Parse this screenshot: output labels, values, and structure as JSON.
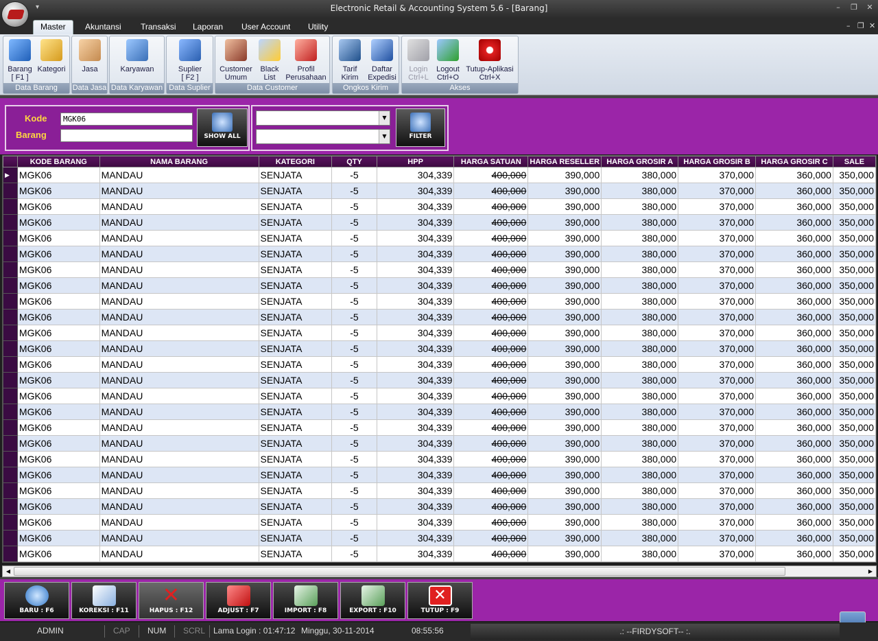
{
  "window": {
    "title": "Electronic Retail  & Accounting System 5.6 - [Barang]",
    "minimize_icon": "minimize-icon",
    "maximize_icon": "maximize-icon",
    "close_icon": "close-icon"
  },
  "menu": {
    "tabs": [
      "Master",
      "Akuntansi",
      "Transaksi",
      "Laporan",
      "User Account",
      "Utility"
    ],
    "active": "Master"
  },
  "ribbon": {
    "groups": [
      {
        "title": "Data Barang",
        "buttons": [
          {
            "label": "Barang",
            "sub": "[ F1 ]",
            "icon": "package-icon"
          },
          {
            "label": "Kategori",
            "sub": "",
            "icon": "tree-icon"
          }
        ]
      },
      {
        "title": "Data Jasa",
        "buttons": [
          {
            "label": "Jasa",
            "sub": "",
            "icon": "handshake-icon"
          }
        ]
      },
      {
        "title": "Data Karyawan",
        "buttons": [
          {
            "label": "Karyawan",
            "sub": "",
            "icon": "people-icon"
          }
        ]
      },
      {
        "title": "Data Suplier",
        "buttons": [
          {
            "label": "Suplier",
            "sub": "[ F2 ]",
            "icon": "truck-icon"
          }
        ]
      },
      {
        "title": "Data Customer",
        "buttons": [
          {
            "label": "Customer",
            "sub": "Umum",
            "icon": "customers-icon"
          },
          {
            "label": "Black",
            "sub": "List",
            "icon": "warning-user-icon"
          },
          {
            "label": "Profil",
            "sub": "Perusahaan",
            "icon": "house-icon"
          }
        ]
      },
      {
        "title": "Ongkos Kirim",
        "buttons": [
          {
            "label": "Tarif",
            "sub": "Kirim",
            "icon": "courier-icon"
          },
          {
            "label": "Daftar",
            "sub": "Expedisi",
            "icon": "delivery-truck-icon"
          }
        ]
      },
      {
        "title": "Akses",
        "buttons": [
          {
            "label": "Login",
            "sub": "Ctrl+L",
            "icon": "key-icon",
            "disabled": true
          },
          {
            "label": "Logout",
            "sub": "Ctrl+O",
            "icon": "logout-icon"
          },
          {
            "label": "Tutup-Aplikasi",
            "sub": "Ctrl+X",
            "icon": "power-icon"
          }
        ]
      }
    ]
  },
  "filter": {
    "kode_label": "Kode",
    "barang_label": "Barang",
    "kode_value": "MGK06",
    "barang_value": "",
    "show_all_label": "SHOW ALL",
    "filter_label": "FILTER",
    "combo1": "",
    "combo2": ""
  },
  "table": {
    "columns": [
      "KODE BARANG",
      "NAMA BARANG",
      "KATEGORI",
      "QTY",
      "HPP",
      "HARGA SATUAN",
      "HARGA RESELLER",
      "HARGA GROSIR A",
      "HARGA GROSIR B",
      "HARGA GROSIR C",
      "SALE"
    ],
    "row_template": {
      "kode": "MGK06",
      "nama": "MANDAU",
      "kategori": "SENJATA",
      "qty": "-5",
      "hpp": "304,339",
      "satuan": "400,000",
      "reseller": "390,000",
      "grosir_a": "380,000",
      "grosir_b": "370,000",
      "grosir_c": "360,000",
      "sale": "350,000"
    },
    "row_count": 25
  },
  "footer": {
    "buttons": [
      {
        "label": "BARU : F6",
        "icon": "new-icon"
      },
      {
        "label": "KOREKSI : F11",
        "icon": "edit-document-icon"
      },
      {
        "label": "HAPUS : F12",
        "icon": "delete-x-icon"
      },
      {
        "label": "ADJUST : F7",
        "icon": "wrench-icon"
      },
      {
        "label": "IMPORT : F8",
        "icon": "import-sheet-icon"
      },
      {
        "label": "EXPORT : F10",
        "icon": "export-sheet-icon"
      },
      {
        "label": "TUTUP : F9",
        "icon": "close-red-icon"
      }
    ]
  },
  "status": {
    "user": "ADMIN",
    "cap": "CAP",
    "num": "NUM",
    "scrl": "SCRL",
    "login": "Lama Login : 01:47:12",
    "date": "Minggu, 30-11-2014",
    "time": "08:55:56",
    "brand": ".:            --FIRDYSOFT--            :."
  }
}
